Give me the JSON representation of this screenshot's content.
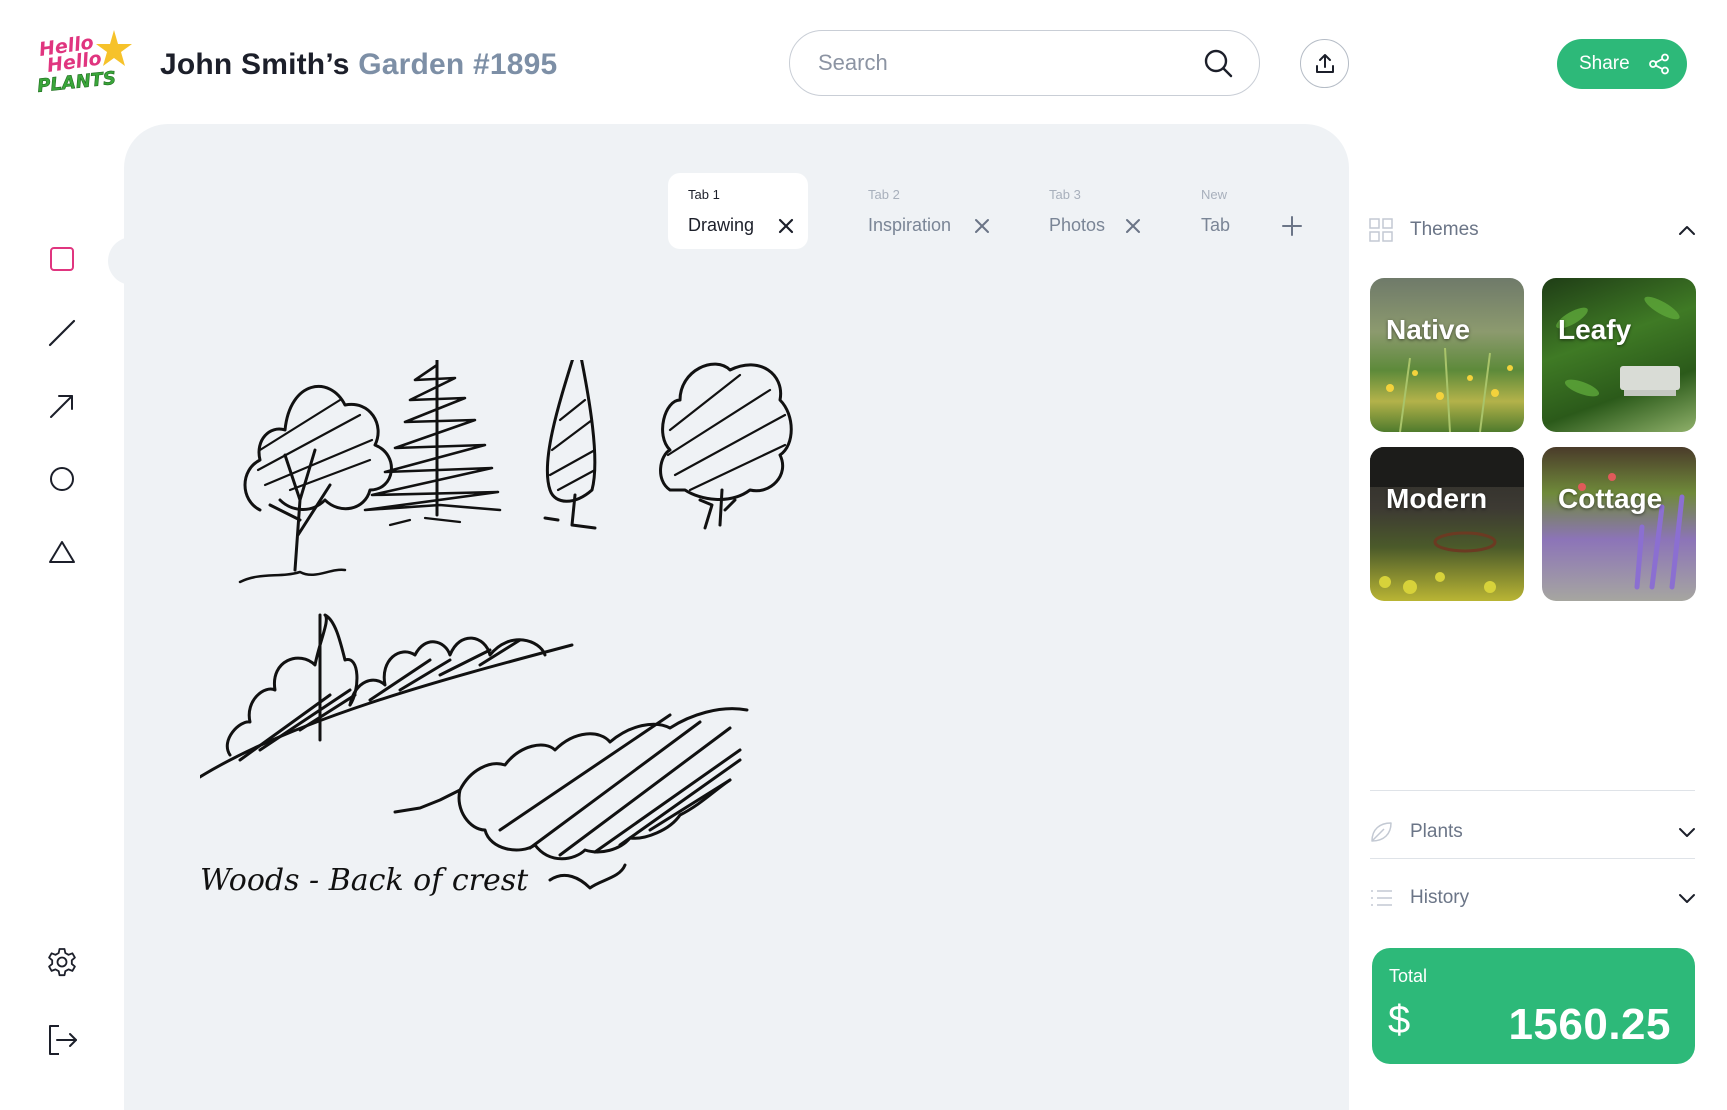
{
  "header": {
    "logo_text": [
      "Hello",
      "Hello",
      "PLANTS"
    ],
    "owner": "John Smith’s",
    "garden": "Garden #1895",
    "search_placeholder": "Search",
    "share_label": "Share"
  },
  "toolbar": {
    "tools": [
      {
        "name": "rectangle-tool",
        "icon": "square-icon"
      },
      {
        "name": "line-tool",
        "icon": "line-icon"
      },
      {
        "name": "arrow-tool",
        "icon": "arrow-icon"
      },
      {
        "name": "circle-tool",
        "icon": "circle-icon"
      },
      {
        "name": "triangle-tool",
        "icon": "triangle-icon"
      }
    ],
    "bottom": [
      {
        "name": "settings-button",
        "icon": "gear-icon"
      },
      {
        "name": "logout-button",
        "icon": "logout-icon"
      }
    ]
  },
  "tabs": [
    {
      "num": "Tab 1",
      "label": "Drawing",
      "active": true
    },
    {
      "num": "Tab 2",
      "label": "Inspiration",
      "active": false
    },
    {
      "num": "Tab 3",
      "label": "Photos",
      "active": false
    },
    {
      "num": "New",
      "label": "Tab",
      "active": false
    }
  ],
  "sketch": {
    "caption": "Woods - Back of crest"
  },
  "sidebar": {
    "themes_label": "Themes",
    "themes": [
      {
        "name": "Native"
      },
      {
        "name": "Leafy"
      },
      {
        "name": "Modern"
      },
      {
        "name": "Cottage"
      }
    ],
    "plants_label": "Plants",
    "history_label": "History",
    "total_label": "Total",
    "currency_symbol": "$",
    "total_value": "1560.25"
  },
  "colors": {
    "accent_green": "#2db979",
    "active_tool_pink": "#e0357f",
    "canvas_bg": "#eff2f5",
    "garden_title": "#7d8fa6"
  }
}
